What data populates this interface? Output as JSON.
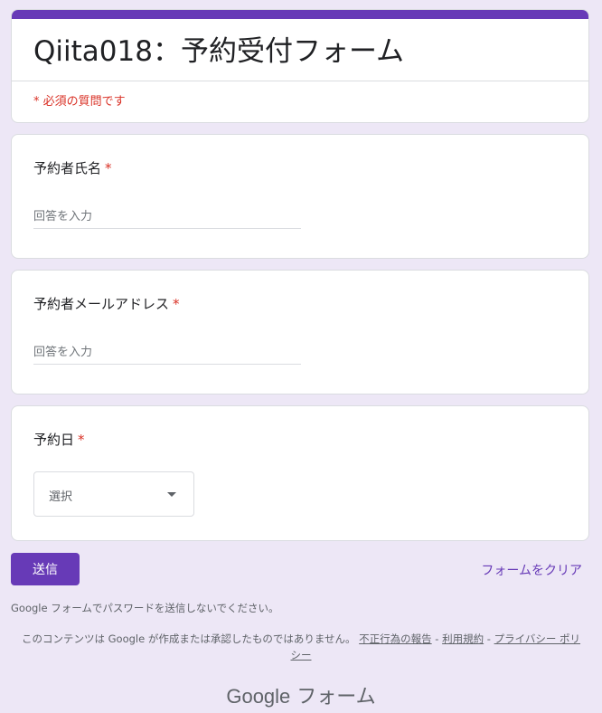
{
  "form": {
    "title": "Qiita018：予約受付フォーム",
    "required_note": "* 必須の質問です",
    "accent_color": "#673ab7"
  },
  "questions": [
    {
      "label": "予約者氏名",
      "required_mark": "*",
      "placeholder": "回答を入力"
    },
    {
      "label": "予約者メールアドレス",
      "required_mark": "*",
      "placeholder": "回答を入力"
    },
    {
      "label": "予約日",
      "required_mark": "*",
      "select_value": "選択",
      "icon": "chevron-down-icon"
    }
  ],
  "actions": {
    "submit_label": "送信",
    "clear_label": "フォームをクリア"
  },
  "footer": {
    "password_warning": "Google フォームでパスワードを送信しないでください。",
    "disclaimer": "このコンテンツは Google が作成または承認したものではありません。",
    "report_link": "不正行為の報告",
    "sep1": " - ",
    "terms_link": "利用規約",
    "sep2": " - ",
    "privacy_link": "プライバシー ポリシー",
    "brand_google": "Google",
    "brand_forms": "フォーム"
  }
}
